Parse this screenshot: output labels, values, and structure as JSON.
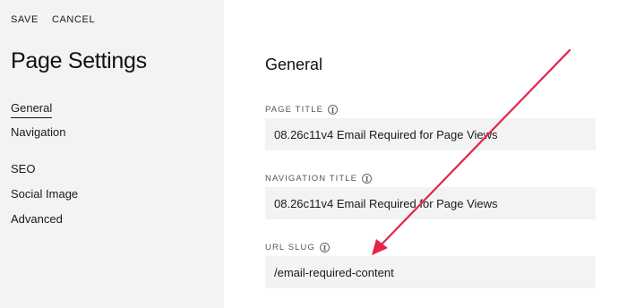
{
  "sidebar": {
    "actions": {
      "save_label": "SAVE",
      "cancel_label": "CANCEL"
    },
    "title": "Page Settings",
    "items": [
      {
        "label": "General",
        "active": true
      },
      {
        "label": "Navigation"
      },
      {
        "label": "SEO"
      },
      {
        "label": "Social Image"
      },
      {
        "label": "Advanced"
      }
    ]
  },
  "main": {
    "section_title": "General",
    "fields": [
      {
        "label": "PAGE TITLE",
        "value": "08.26c11v4 Email Required for Page Views"
      },
      {
        "label": "NAVIGATION TITLE",
        "value": "08.26c11v4 Email Required for Page Views"
      },
      {
        "label": "URL SLUG",
        "value": "/email-required-content"
      }
    ]
  },
  "annotation": {
    "arrow_color": "#e3244a"
  },
  "icons": {
    "info": "info-circle-icon"
  }
}
